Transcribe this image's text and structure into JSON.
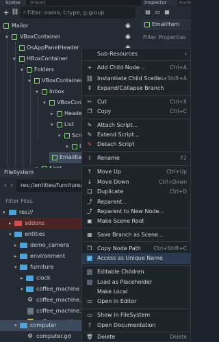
{
  "tabs": {
    "scene": "Scene",
    "import": "Import",
    "inspector": "Inspector",
    "node": "Node"
  },
  "scene_toolbar": {
    "filter_placeholder": "Filter: name, t:type, g:group"
  },
  "tree": [
    {
      "label": "Mailor",
      "icon": "control-node-icon"
    },
    {
      "label": "VBoxContainer",
      "icon": "vbox-icon"
    },
    {
      "label": "OsAppPanelHeader",
      "icon": "control-node-icon"
    },
    {
      "label": "HBoxContainer",
      "icon": "hbox-icon"
    },
    {
      "label": "Folders",
      "icon": "control-node-icon"
    },
    {
      "label": "VBoxContainer",
      "icon": "vbox-icon"
    },
    {
      "label": "Inbox",
      "icon": "control-node-icon"
    },
    {
      "label": "VBoxContainer",
      "icon": "vbox-icon"
    },
    {
      "label": "Header",
      "icon": "control-node-icon"
    },
    {
      "label": "List",
      "icon": "control-node-icon"
    },
    {
      "label": "ScrollContai",
      "icon": "scroll-icon"
    },
    {
      "label": "ItemContai",
      "icon": "vbox-icon"
    },
    {
      "label": "EmailItem",
      "icon": "control-node-icon"
    },
    {
      "label": "Sent",
      "icon": "control-node-icon"
    }
  ],
  "inspector": {
    "node_name": "EmailItem",
    "filter": "Filter Properties"
  },
  "filesystem": {
    "tab": "FileSystem",
    "path": "res://entities/furniture/cor",
    "filter": "Filter Files",
    "items": [
      {
        "label": "res://",
        "kind": "folder"
      },
      {
        "label": "addons",
        "kind": "folder"
      },
      {
        "label": "entities",
        "kind": "folder"
      },
      {
        "label": "demo_camera",
        "kind": "folder"
      },
      {
        "label": "environment",
        "kind": "folder"
      },
      {
        "label": "furniture",
        "kind": "folder"
      },
      {
        "label": "clock",
        "kind": "folder"
      },
      {
        "label": "coffee_machine",
        "kind": "folder"
      },
      {
        "label": "coffee_machine.gd",
        "kind": "script"
      },
      {
        "label": "coffee_machine.tscn",
        "kind": "scene"
      },
      {
        "label": "coffee_machine_ma",
        "kind": "scene"
      },
      {
        "label": "computer",
        "kind": "folder"
      },
      {
        "label": "computer.gd",
        "kind": "script"
      }
    ]
  },
  "menu": [
    {
      "label": "Sub-Resources",
      "shortcut": "",
      "icon": "",
      "submenu": true
    },
    {
      "sep": true
    },
    {
      "label": "Add Child Node...",
      "shortcut": "Ctrl+A",
      "icon": "plus-icon"
    },
    {
      "label": "Instantiate Child Scene...",
      "shortcut": "Ctrl+Shift+A",
      "icon": "link-icon"
    },
    {
      "label": "Expand/Collapse Branch",
      "shortcut": "",
      "icon": "collapse-icon"
    },
    {
      "sep": true
    },
    {
      "label": "Cut",
      "shortcut": "Ctrl+X",
      "icon": "cut-icon"
    },
    {
      "label": "Copy",
      "shortcut": "Ctrl+C",
      "icon": "copy-icon"
    },
    {
      "sep": true
    },
    {
      "label": "Attach Script...",
      "shortcut": "",
      "icon": "script-add-icon"
    },
    {
      "label": "Extend Script...",
      "shortcut": "",
      "icon": "script-extend-icon"
    },
    {
      "label": "Detach Script",
      "shortcut": "",
      "icon": "script-remove-icon"
    },
    {
      "sep": true
    },
    {
      "label": "Rename",
      "shortcut": "F2",
      "icon": "rename-icon"
    },
    {
      "sep": true
    },
    {
      "label": "Move Up",
      "shortcut": "Ctrl+Up",
      "icon": "move-up-icon"
    },
    {
      "label": "Move Down",
      "shortcut": "Ctrl+Down",
      "icon": "move-down-icon"
    },
    {
      "label": "Duplicate",
      "shortcut": "Ctrl+D",
      "icon": "duplicate-icon"
    },
    {
      "label": "Reparent...",
      "shortcut": "",
      "icon": "reparent-icon"
    },
    {
      "label": "Reparent to New Node...",
      "shortcut": "",
      "icon": "reparent-new-icon"
    },
    {
      "label": "Make Scene Root",
      "shortcut": "",
      "icon": "root-icon"
    },
    {
      "sep": true
    },
    {
      "label": "Save Branch as Scene...",
      "shortcut": "",
      "icon": "save-icon"
    },
    {
      "sep": true
    },
    {
      "label": "Copy Node Path",
      "shortcut": "Ctrl+Shift+C",
      "icon": "copy-path-icon"
    },
    {
      "label": "Access as Unique Name",
      "shortcut": "",
      "icon": "checkbox-checked-icon",
      "checked": true
    },
    {
      "sep": true
    },
    {
      "label": "Editable Children",
      "shortcut": "",
      "icon": "checkbox-icon"
    },
    {
      "label": "Load as Placeholder",
      "shortcut": "",
      "icon": "checkbox-icon"
    },
    {
      "label": "Make Local",
      "shortcut": "",
      "icon": "make-local-icon"
    },
    {
      "label": "Open in Editor",
      "shortcut": "",
      "icon": "open-icon"
    },
    {
      "sep": true
    },
    {
      "label": "Show in FileSystem",
      "shortcut": "",
      "icon": "filesystem-icon"
    },
    {
      "label": "Open Documentation",
      "shortcut": "",
      "icon": "help-icon"
    },
    {
      "sep": true
    },
    {
      "label": "Delete",
      "shortcut": "Delete",
      "icon": "delete-icon"
    }
  ],
  "colors": {
    "accent": "#4fa3d8",
    "node_green": "#8ed77c",
    "selection": "#3d4a5e",
    "menu_bg": "#1f242b"
  }
}
